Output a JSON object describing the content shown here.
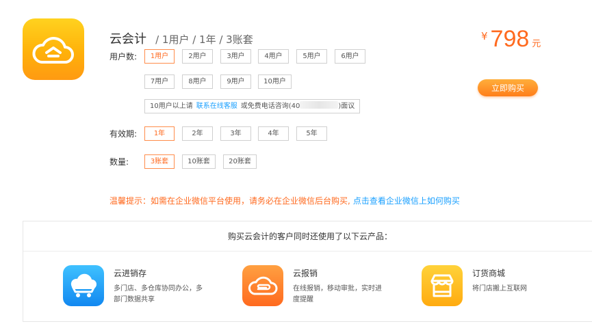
{
  "product": {
    "name": "云会计",
    "spec": "/ 1用户 / 1年 / 3账套",
    "icon": "cloud-app-icon"
  },
  "price": {
    "currency": "¥",
    "amount": "798",
    "unit": "元"
  },
  "buy_button": "立即购买",
  "users": {
    "label": "用户数:",
    "options": [
      "1用户",
      "2用户",
      "3用户",
      "4用户",
      "5用户",
      "6用户",
      "7用户",
      "8用户",
      "9用户",
      "10用户"
    ],
    "selected": "1用户",
    "contact_prefix": "10用户以上请",
    "contact_link": "联系在线客服",
    "contact_phone_prefix": "或免费电话咨询(40",
    "contact_suffix": ")面议"
  },
  "period": {
    "label": "有效期:",
    "options": [
      "1年",
      "2年",
      "3年",
      "4年",
      "5年"
    ],
    "selected": "1年"
  },
  "quantity": {
    "label": "数量:",
    "options": [
      "3账套",
      "10账套",
      "20账套"
    ],
    "selected": "3账套"
  },
  "tip": {
    "text": "温馨提示：如需在企业微信平台使用，请务必在企业微信后台购买,",
    "link": "点击查看企业微信上如何购买"
  },
  "related": {
    "header": "购买云会计的客户同时还使用了以下云产品：",
    "products": [
      {
        "name": "云进销存",
        "desc": "多门店、多仓库协同办公，多部门数据共享",
        "icon": "cloud-cart-icon",
        "color": "#1e9cf5"
      },
      {
        "name": "云报销",
        "desc": "在线报销，移动审批，实时进度提醒",
        "icon": "cloud-clip-icon",
        "color": "#ff7b26"
      },
      {
        "name": "订货商城",
        "desc": "将门店搬上互联网",
        "icon": "storefront-icon",
        "color": "#ffb319"
      }
    ]
  }
}
